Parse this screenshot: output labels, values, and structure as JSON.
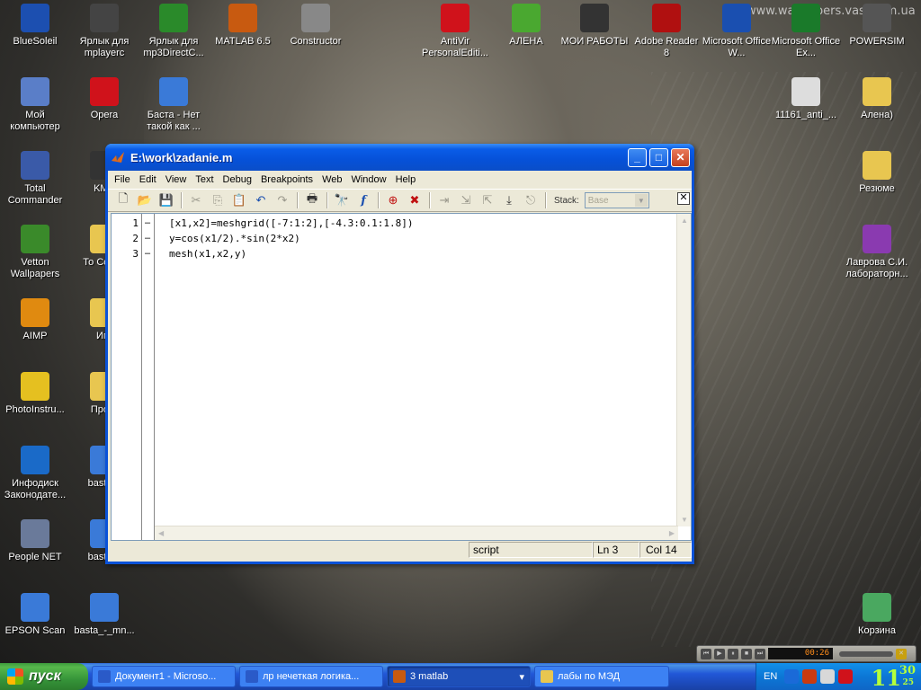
{
  "desktop": {
    "watermark": "www.wallpapers.vasi.com.ua",
    "icons_left": [
      {
        "label": "BlueSoleil",
        "icon": "bluetooth-icon",
        "color": "#1c4fb0"
      },
      {
        "label": "Мой компьютер",
        "icon": "computer-icon",
        "color": "#5a7ec8"
      },
      {
        "label": "Total Commander",
        "icon": "floppy-icon",
        "color": "#3a5aa8"
      },
      {
        "label": "Vetton Wallpapers",
        "icon": "monitor-icon",
        "color": "#3a8a2a"
      },
      {
        "label": "AIMP",
        "icon": "aimp-icon",
        "color": "#e08a10"
      },
      {
        "label": "PhotoInstru...",
        "icon": "smiley-icon",
        "color": "#e5c020"
      },
      {
        "label": "Инфодиск Законодате...",
        "icon": "infodisk-icon",
        "color": "#1a6ac8"
      },
      {
        "label": "People NET",
        "icon": "network-icon",
        "color": "#6a7a9a"
      },
      {
        "label": "EPSON Scan",
        "icon": "scanner-icon",
        "color": "#3a7ad8"
      }
    ],
    "icons_col2": [
      {
        "label": "Ярлык для mplayerc",
        "icon": "mplayer-icon",
        "color": "#444"
      },
      {
        "label": "Opera",
        "icon": "opera-icon",
        "color": "#d0121b"
      },
      {
        "label": "KMP",
        "icon": "kmp-icon",
        "color": "#333"
      },
      {
        "label": "То Comm",
        "icon": "folder-icon",
        "color": "#e8c650"
      },
      {
        "label": "Игр",
        "icon": "folder-icon",
        "color": "#e8c650"
      },
      {
        "label": "Прогр",
        "icon": "folder-icon",
        "color": "#e8c650"
      },
      {
        "label": "basta_-",
        "icon": "media-file-icon",
        "color": "#3a7ad8"
      },
      {
        "label": "basta_-",
        "icon": "media-file-icon",
        "color": "#3a7ad8"
      },
      {
        "label": "basta_-_mn...",
        "icon": "media-file-icon",
        "color": "#3a7ad8"
      }
    ],
    "icons_col3": [
      {
        "label": "Ярлык для mp3DirectC...",
        "icon": "mp3cut-icon",
        "color": "#2a8a2a"
      },
      {
        "label": "Баста - Нет такой как ...",
        "icon": "media-file-icon",
        "color": "#3a7ad8"
      }
    ],
    "icons_top": [
      {
        "label": "MATLAB 6.5",
        "icon": "matlab-icon",
        "color": "#c85a10"
      },
      {
        "label": "Constructor",
        "icon": "constructor-icon",
        "color": "#888"
      },
      {
        "label": "AntiVir PersonalEditi...",
        "icon": "antivir-icon",
        "color": "#d0121b"
      },
      {
        "label": "АЛЕНА",
        "icon": "msn-icon",
        "color": "#4aa830"
      },
      {
        "label": "МОИ РАБОТЫ",
        "icon": "folder-dark-icon",
        "color": "#333"
      },
      {
        "label": "Adobe Reader 8",
        "icon": "pdf-icon",
        "color": "#b01010"
      },
      {
        "label": "Microsoft Office W...",
        "icon": "word-icon",
        "color": "#1a4fb0"
      },
      {
        "label": "Microsoft Office Ex...",
        "icon": "excel-icon",
        "color": "#1a7a2a"
      },
      {
        "label": "POWERSIM",
        "icon": "powersim-icon",
        "color": "#555"
      }
    ],
    "icons_right": [
      {
        "label": "11161_anti_...",
        "icon": "quicktime-icon",
        "color": "#ddd"
      },
      {
        "label": "Алена)",
        "icon": "folder-icon",
        "color": "#e8c650"
      },
      {
        "label": "Резюме",
        "icon": "folder-icon",
        "color": "#e8c650"
      },
      {
        "label": "Лаврова С.И. лабораторн...",
        "icon": "winrar-icon",
        "color": "#8a3ab0"
      },
      {
        "label": "Корзина",
        "icon": "recycle-bin-icon",
        "color": "#4aa860"
      }
    ]
  },
  "window": {
    "title": "E:\\work\\zadanie.m",
    "menu": [
      "File",
      "Edit",
      "View",
      "Text",
      "Debug",
      "Breakpoints",
      "Web",
      "Window",
      "Help"
    ],
    "stack_label": "Stack:",
    "stack_value": "Base",
    "code_lines": [
      {
        "num": "1",
        "mark": "–",
        "text": "[x1,x2]=meshgrid([-7:1:2],[-4.3:0.1:1.8])"
      },
      {
        "num": "2",
        "mark": "–",
        "text": "y=cos(x1/2).*sin(2*x2)"
      },
      {
        "num": "3",
        "mark": "–",
        "text": "mesh(x1,x2,y)"
      }
    ],
    "status": {
      "mode": "script",
      "line": "Ln 3",
      "col": "Col 14"
    }
  },
  "taskbar": {
    "start_label": "пуск",
    "tasks": [
      {
        "label": "Документ1 - Microso...",
        "color": "#2a5ac8",
        "active": false
      },
      {
        "label": "лр нечеткая логика...",
        "color": "#2a5ac8",
        "active": false
      },
      {
        "label": "3 matlab",
        "color": "#c85a10",
        "active": true
      },
      {
        "label": "лабы по МЭД",
        "color": "#e8c650",
        "active": false
      }
    ],
    "lang": "EN",
    "clock": {
      "hours": "11",
      "minutes": "30",
      "seconds": "25"
    }
  },
  "player": {
    "time": "00:26"
  }
}
